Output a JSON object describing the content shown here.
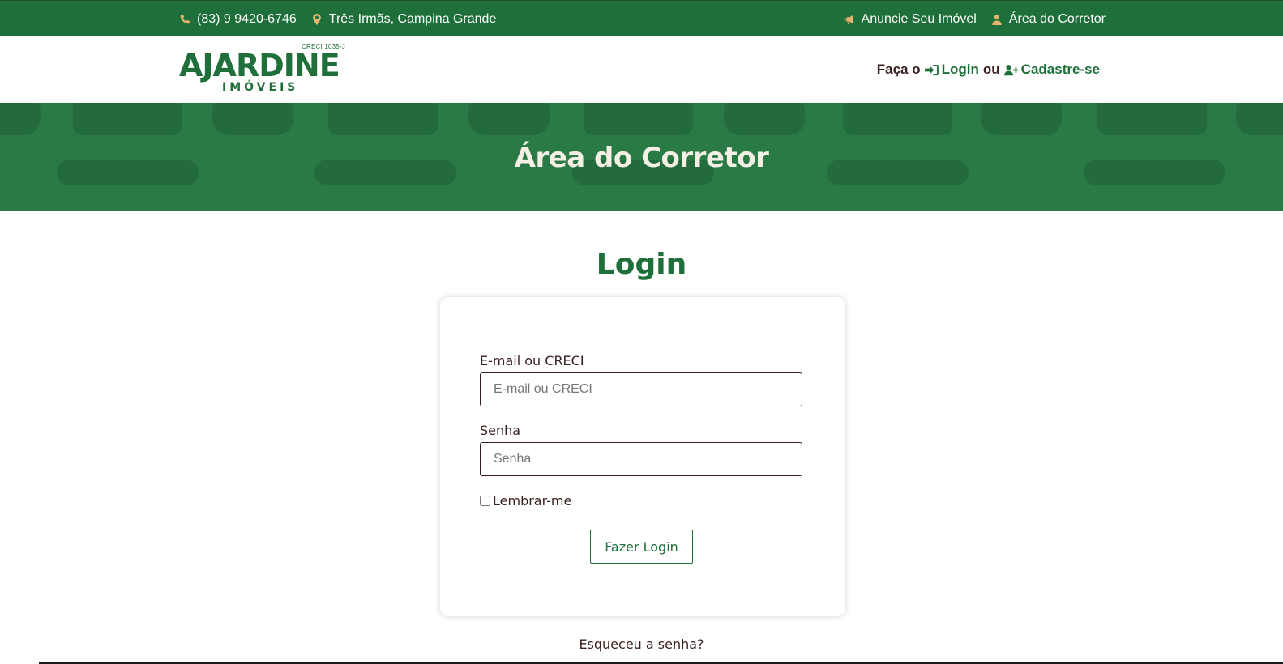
{
  "topbar": {
    "phone": "(83) 9 9420-6746",
    "location": "Três Irmãs, Campina Grande",
    "announce": "Anuncie Seu Imóvel",
    "broker_area": "Área do Corretor",
    "icon_color": "#e9b36d"
  },
  "header": {
    "logo_creci": "CRECI 1035-J",
    "logo_brand": "AJARDINE",
    "logo_sub": "IMÓVEIS",
    "auth_prefix": "Faça o",
    "login_label": "Login",
    "auth_or": "ou",
    "register_label": "Cadastre-se"
  },
  "banner": {
    "title": "Área do Corretor"
  },
  "main": {
    "title": "Login",
    "email_label": "E-mail ou CRECI",
    "email_placeholder": "E-mail ou CRECI",
    "email_value": "",
    "password_label": "Senha",
    "password_placeholder": "Senha",
    "password_value": "",
    "remember_label": "Lembrar-me",
    "submit_label": "Fazer Login",
    "forgot_label": "Esqueceu a senha?"
  },
  "colors": {
    "brand_green": "#1f6f3a",
    "banner_green": "#2a7a45",
    "text_brown": "#3a1f1f"
  },
  "icons": [
    "phone-icon",
    "map-pin-icon",
    "bullhorn-icon",
    "user-icon",
    "sign-in-icon",
    "user-plus-icon"
  ]
}
